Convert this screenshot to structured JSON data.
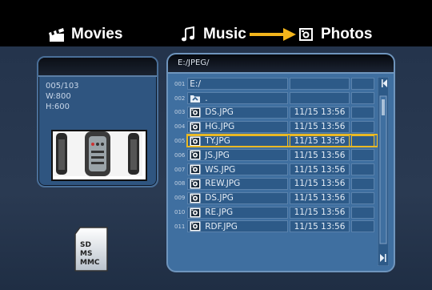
{
  "tabs": {
    "movies": "Movies",
    "music": "Music",
    "photos": "Photos"
  },
  "info": {
    "index": "005/103",
    "width": "W:800",
    "height": "H:600"
  },
  "card": {
    "line1": "SD",
    "line2": "MS",
    "line3": "MMC"
  },
  "browser": {
    "path": "E:/JPEG/",
    "rows": [
      {
        "num": "001",
        "name": "E:/",
        "date": "",
        "icon": "drive-icon"
      },
      {
        "num": "002",
        "name": ".",
        "date": "",
        "icon": "folder-up-icon"
      },
      {
        "num": "003",
        "name": "DS.JPG",
        "date": "11/15 13:56",
        "icon": "photo-icon"
      },
      {
        "num": "004",
        "name": "HG.JPG",
        "date": "11/15 13:56",
        "icon": "photo-icon"
      },
      {
        "num": "005",
        "name": "TY.JPG",
        "date": "11/15 13:56",
        "icon": "photo-icon"
      },
      {
        "num": "006",
        "name": "JS.JPG",
        "date": "11/15 13:56",
        "icon": "photo-icon"
      },
      {
        "num": "007",
        "name": "WS.JPG",
        "date": "11/15 13:56",
        "icon": "photo-icon"
      },
      {
        "num": "008",
        "name": "REW.JPG",
        "date": "11/15 13:56",
        "icon": "photo-icon"
      },
      {
        "num": "009",
        "name": "DS.JPG",
        "date": "11/15 13:56",
        "icon": "photo-icon"
      },
      {
        "num": "010",
        "name": "RE.JPG",
        "date": "11/15 13:56",
        "icon": "photo-icon"
      },
      {
        "num": "011",
        "name": "RDF.JPG",
        "date": "11/15 13:56",
        "icon": "photo-icon"
      }
    ],
    "selected_row": "005"
  },
  "colors": {
    "highlight": "#e9b824",
    "arrow": "#f3b51c",
    "panel": "#3f6fa0"
  }
}
